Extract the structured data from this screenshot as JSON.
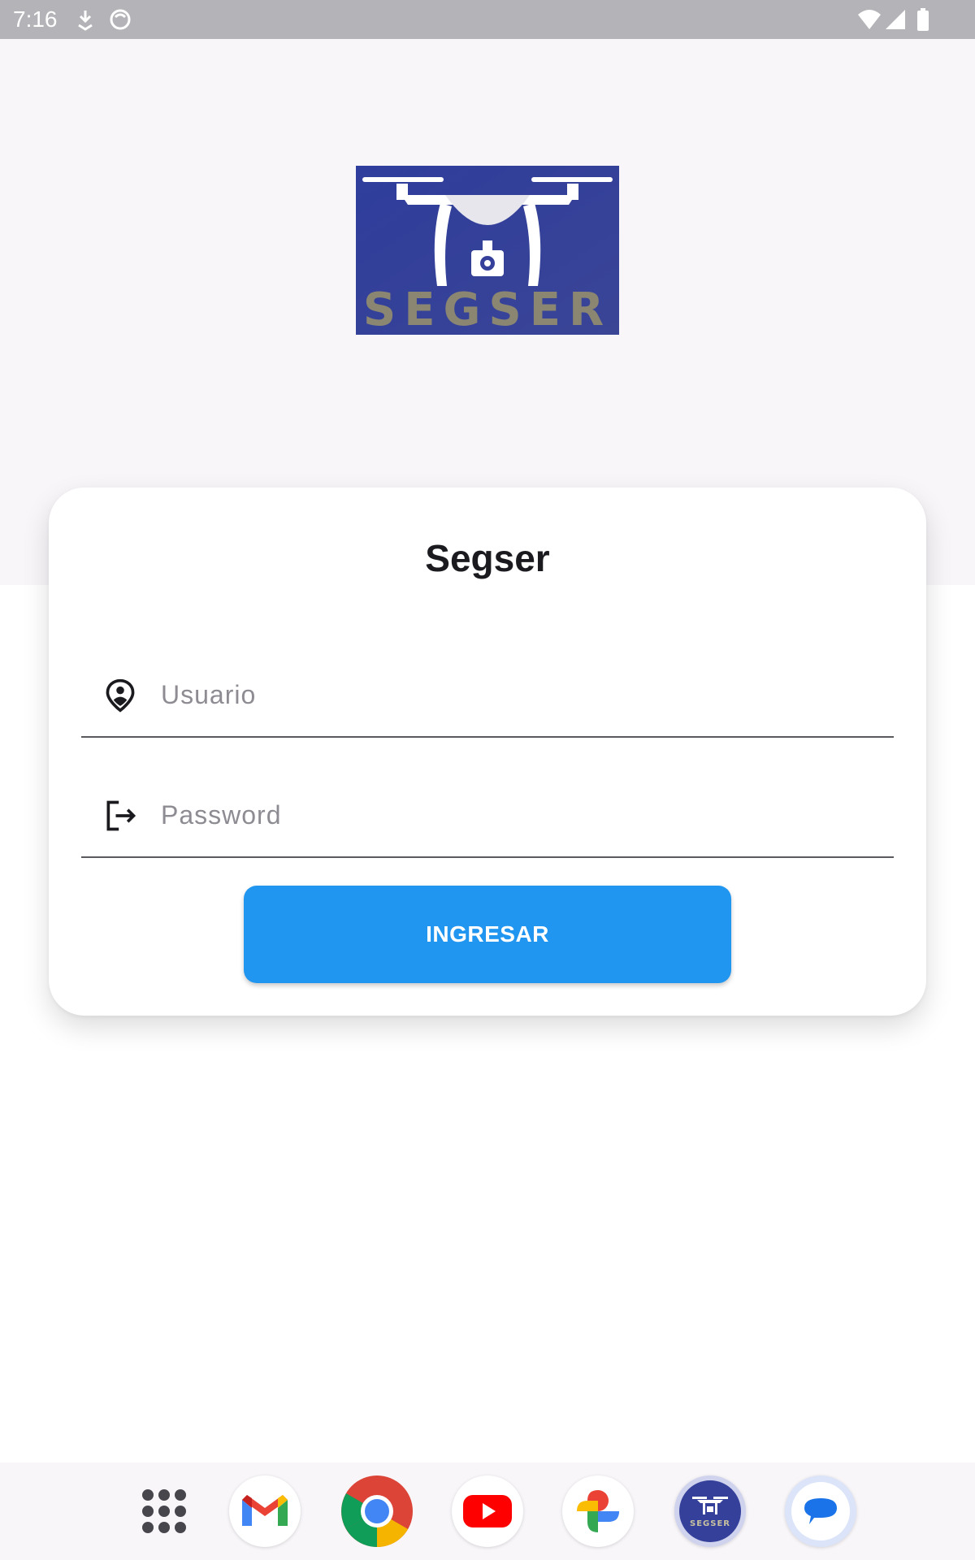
{
  "status_bar": {
    "time": "7:16",
    "icons": [
      "download-icon",
      "notification-face-icon",
      "wifi-icon",
      "signal-icon",
      "battery-icon"
    ]
  },
  "logo": {
    "brand_text": "SEGSER",
    "colors": {
      "background": "#34409a",
      "drone": "#ffffff",
      "text": "#8a8672"
    }
  },
  "card": {
    "title": "Segser",
    "username": {
      "placeholder": "Usuario",
      "value": "",
      "icon": "person-pin-icon"
    },
    "password": {
      "placeholder": "Password",
      "value": "",
      "icon": "logout-icon"
    },
    "submit_label": "INGRESAR"
  },
  "dock": {
    "apps": [
      "app-drawer-icon",
      "gmail-icon",
      "chrome-icon",
      "youtube-icon",
      "photos-icon",
      "segser-app-icon",
      "messages-icon"
    ]
  },
  "colors": {
    "accent": "#2196f0",
    "background": "#f8f6f9",
    "status_bar": "#b4b4b8"
  }
}
